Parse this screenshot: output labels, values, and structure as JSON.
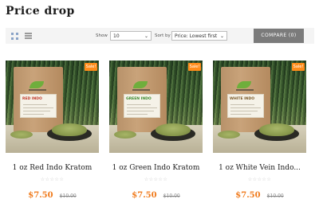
{
  "page": {
    "title": "Price drop"
  },
  "toolbar": {
    "show_label": "Show",
    "show_value": "10",
    "sort_label": "Sort by",
    "sort_value": "Price: Lowest first",
    "compare_label": "COMPARE (0)"
  },
  "colors": {
    "accent_price": "#f07b1d",
    "sale_badge": "#ff8c1a",
    "compare_button": "#7b7b7b",
    "toolbar_bg": "#f4f4f4"
  },
  "products": [
    {
      "title": "1 oz Red Indo Kratom",
      "badge": "Sale!",
      "bag_label": "RED INDO",
      "bag_label_color": "#c0392b",
      "stars": "☆☆☆☆☆",
      "price": "$7.50",
      "old_price": "$10.00"
    },
    {
      "title": "1 oz Green Indo Kratom",
      "badge": "Sale!",
      "bag_label": "GREEN INDO",
      "bag_label_color": "#3c8a2e",
      "stars": "☆☆☆☆☆",
      "price": "$7.50",
      "old_price": "$10.00"
    },
    {
      "title": "1 oz White Vein Indo...",
      "badge": "Sale!",
      "bag_label": "WHITE INDO",
      "bag_label_color": "#7a5a2a",
      "stars": "☆☆☆☆☆",
      "price": "$7.50",
      "old_price": "$10.00"
    }
  ]
}
